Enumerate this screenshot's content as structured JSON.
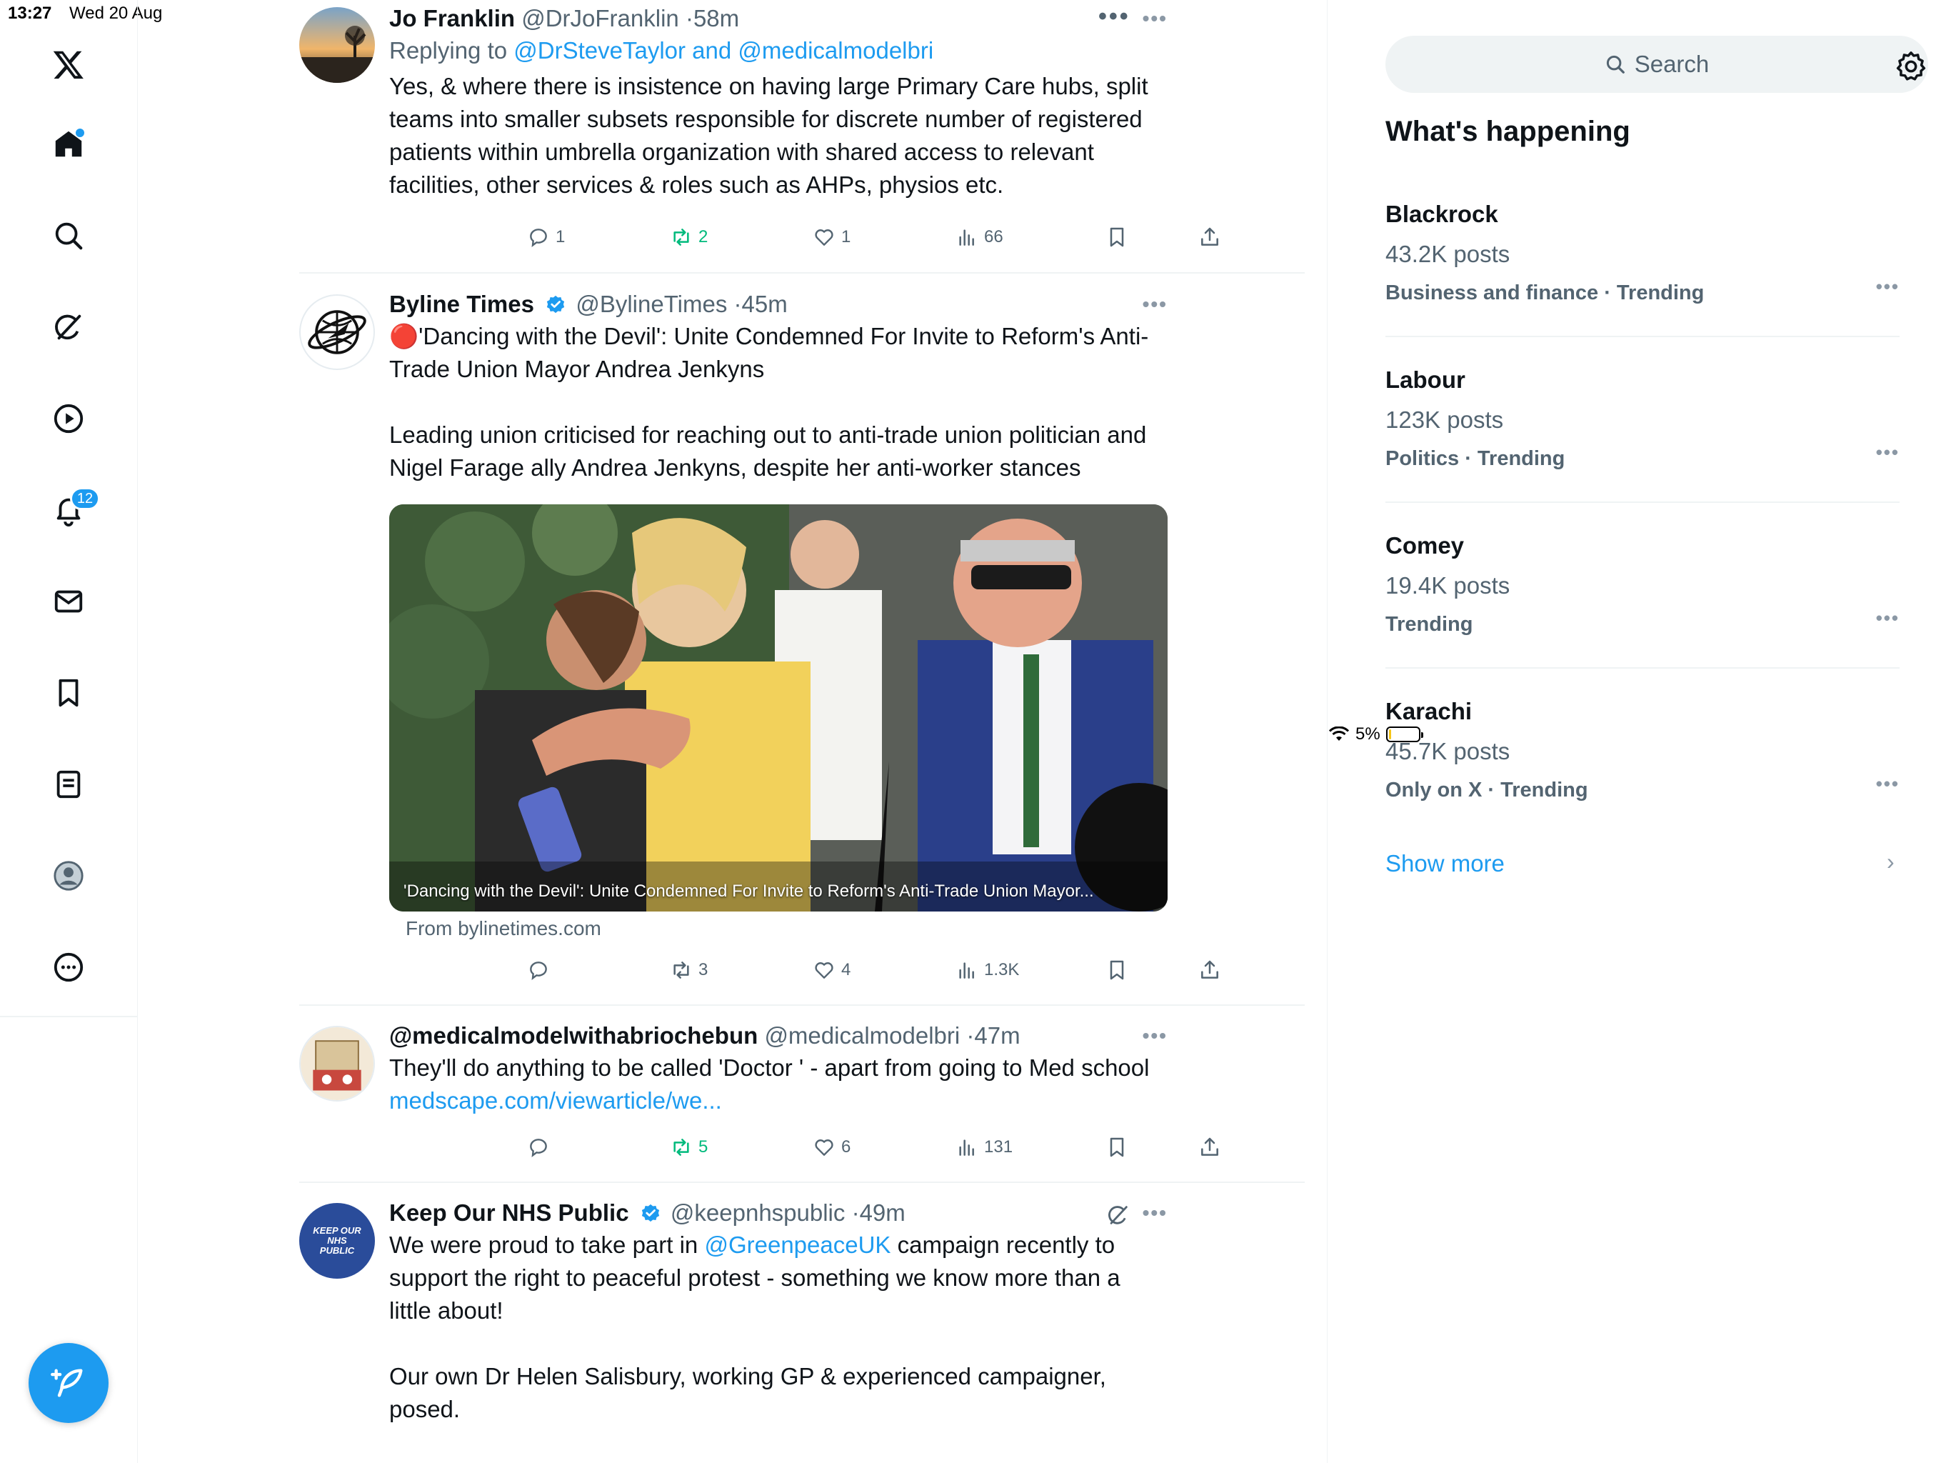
{
  "status_bar": {
    "time": "13:27",
    "date": "Wed 20 Aug",
    "battery": "5%",
    "battery_level": 0.05
  },
  "nav": {
    "notifications_badge": "12",
    "items": [
      "x-logo-icon",
      "home-icon",
      "search-icon",
      "grok-icon",
      "video-icon",
      "notifications-icon",
      "messages-icon",
      "bookmarks-icon",
      "lists-icon",
      "profile-icon",
      "more-icon"
    ]
  },
  "feed": {
    "tweets": [
      {
        "name": "Jo Franklin",
        "handle": "@DrJoFranklin",
        "time": "58m",
        "replying_prefix": "Replying to",
        "replying_handles": "@DrSteveTaylor and @medicalmodelbri",
        "text": "Yes, & where there is insistence on having large Primary Care hubs, split teams into smaller subsets responsible for discrete number of registered patients within umbrella organization with shared access to relevant facilities, other services & roles such as AHPs, physios etc.",
        "replies": "1",
        "reposts": "2",
        "likes": "1",
        "views": "66"
      },
      {
        "name": "Byline Times",
        "handle": "@BylineTimes",
        "time": "45m",
        "text1": "🔴'Dancing with the Devil': Unite Condemned For Invite to Reform's Anti-Trade Union Mayor Andrea Jenkyns",
        "text2": "Leading union criticised for reaching out to anti-trade union politician and Nigel Farage ally Andrea Jenkyns, despite her anti-worker stances",
        "media_caption": "'Dancing with the Devil': Unite Condemned For Invite to Reform's Anti-Trade Union Mayor...",
        "from": "From bylinetimes.com",
        "replies": "",
        "reposts": "3",
        "likes": "4",
        "views": "1.3K"
      },
      {
        "name": "@medicalmodelwithabriochebun",
        "handle": "@medicalmodelbri",
        "time": "47m",
        "text": "They'll do anything to be called 'Doctor ' - apart from going to Med school",
        "link": "medscape.com/viewarticle/we...",
        "replies": "",
        "reposts": "5",
        "likes": "6",
        "views": "131"
      },
      {
        "name": "Keep Our NHS Public",
        "handle": "@keepnhspublic",
        "time": "49m",
        "text_pre": "We were proud to take part in",
        "mention": "@GreenpeaceUK",
        "text_post": "campaign recently to support the right to peaceful protest - something we know more than a little about!",
        "text2": "Our own Dr Helen Salisbury, working GP & experienced campaigner, posed.",
        "avatar_text": "KEEP OUR NHS PUBLIC"
      }
    ]
  },
  "sidebar": {
    "search_placeholder": "Search",
    "heading": "What's happening",
    "trends": [
      {
        "title": "Blackrock",
        "posts": "43.2K posts",
        "category": "Business and finance · Trending"
      },
      {
        "title": "Labour",
        "posts": "123K posts",
        "category": "Politics · Trending"
      },
      {
        "title": "Comey",
        "posts": "19.4K posts",
        "category": "Trending"
      },
      {
        "title": "Karachi",
        "posts": "45.7K posts",
        "category": "Only on X · Trending"
      }
    ],
    "show_more": "Show more"
  },
  "colors": {
    "accent": "#1d9bf0",
    "repost_green": "#00ba7c",
    "muted": "#536471"
  }
}
